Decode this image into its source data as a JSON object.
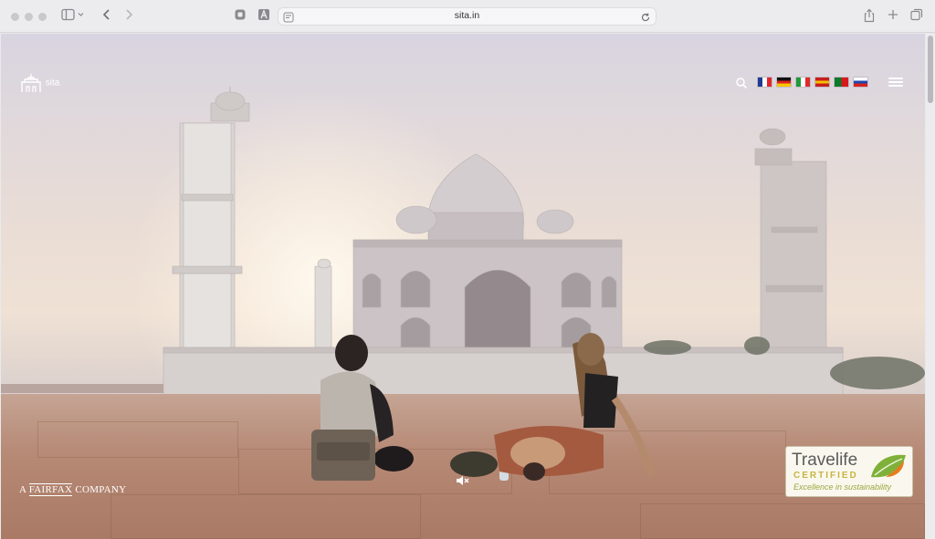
{
  "browser": {
    "url": "sita.in"
  },
  "site": {
    "logo_text": "sita",
    "languages": [
      {
        "code": "fr",
        "colors": [
          "#1f3b95",
          "#ffffff",
          "#e1262c"
        ],
        "orientation": "vertical"
      },
      {
        "code": "de",
        "colors": [
          "#111111",
          "#dd1f1f",
          "#f7c600"
        ],
        "orientation": "horizontal"
      },
      {
        "code": "it",
        "colors": [
          "#1f9a3a",
          "#ffffff",
          "#dd2b2b"
        ],
        "orientation": "vertical"
      },
      {
        "code": "es",
        "colors": [
          "#c91e1e",
          "#f5c000",
          "#c91e1e"
        ],
        "orientation": "horizontal"
      },
      {
        "code": "pt",
        "colors": [
          "#0b7a2a",
          "#d9181d"
        ],
        "orientation": "vertical"
      },
      {
        "code": "ru",
        "colors": [
          "#ffffff",
          "#1f47b0",
          "#d62222"
        ],
        "orientation": "horizontal"
      }
    ],
    "fairfax": {
      "prefix": "A",
      "brand": "FAIRFAX",
      "suffix": "COMPANY"
    },
    "badge": {
      "brand": "Travelife",
      "certified": "CERTIFIED",
      "tagline": "Excellence in sustainability"
    }
  },
  "icons": {
    "search": "search-icon",
    "menu": "hamburger-menu-icon",
    "mute": "speaker-muted-icon"
  }
}
